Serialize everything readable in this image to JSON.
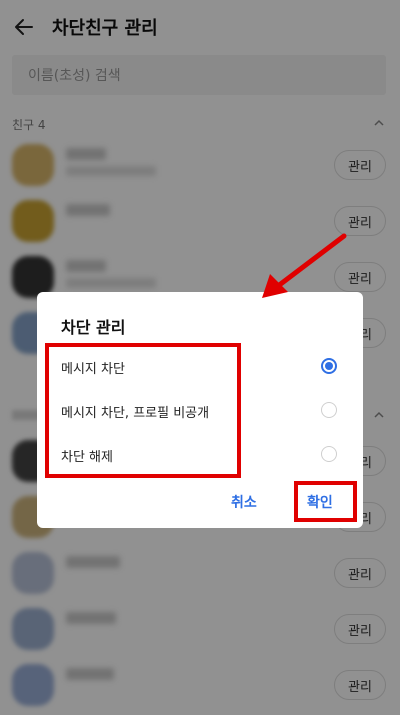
{
  "header": {
    "title": "차단친구 관리"
  },
  "search": {
    "placeholder": "이름(초성) 검색"
  },
  "section": {
    "label": "친구 4"
  },
  "manage_label": "관리",
  "friends": [
    {
      "color": "#d7b56a",
      "sub": true
    },
    {
      "color": "#c8a232",
      "sub": false
    },
    {
      "color": "#333333",
      "sub": true
    },
    {
      "color": "#86a3c8",
      "sub": false
    },
    {
      "color": "#444444",
      "sub": true
    },
    {
      "color": "#cdb47e",
      "sub": false
    },
    {
      "color": "#b8c2d8",
      "sub": false
    },
    {
      "color": "#9db0d0",
      "sub": false
    },
    {
      "color": "#9aaed6",
      "sub": false
    }
  ],
  "dialog": {
    "title": "차단 관리",
    "options": [
      {
        "label": "메시지 차단",
        "checked": true
      },
      {
        "label": "메시지 차단, 프로필 비공개",
        "checked": false
      },
      {
        "label": "차단 해제",
        "checked": false
      }
    ],
    "cancel": "취소",
    "confirm": "확인"
  },
  "colors": {
    "accent": "#2f6fe4",
    "annotation": "#e00000"
  }
}
